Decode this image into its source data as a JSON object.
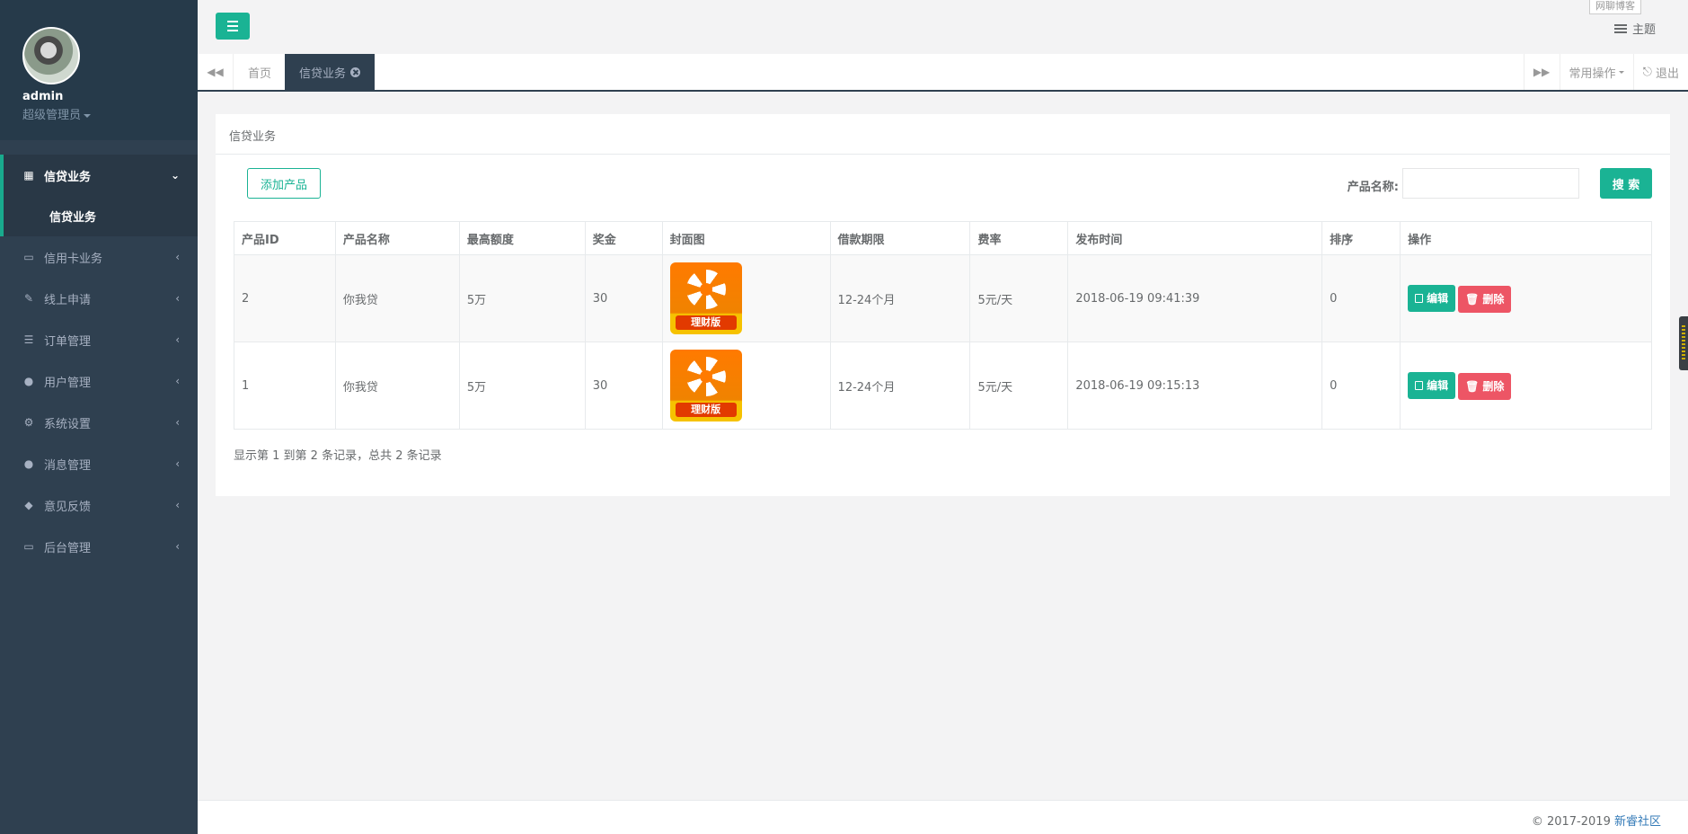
{
  "user": {
    "name": "admin",
    "role": "超级管理员"
  },
  "sidebar": {
    "items": [
      {
        "label": "信贷业务",
        "icon": "calendar-icon",
        "active": true
      },
      {
        "label": "信用卡业务",
        "icon": "credit-card-icon"
      },
      {
        "label": "线上申请",
        "icon": "edit-icon"
      },
      {
        "label": "订单管理",
        "icon": "list-icon"
      },
      {
        "label": "用户管理",
        "icon": "user-icon"
      },
      {
        "label": "系统设置",
        "icon": "gears-icon"
      },
      {
        "label": "消息管理",
        "icon": "comment-icon"
      },
      {
        "label": "意见反馈",
        "icon": "tag-icon"
      },
      {
        "label": "后台管理",
        "icon": "desktop-icon"
      }
    ],
    "sub_item": "信贷业务"
  },
  "topbar": {
    "theme_label": "主题",
    "tooltip": "网聊博客"
  },
  "tabs": {
    "home": "首页",
    "current": "信贷业务",
    "common_ops": "常用操作",
    "logout": "退出"
  },
  "panel": {
    "title": "信贷业务",
    "add_button": "添加产品",
    "search_label": "产品名称:",
    "search_value": "",
    "search_button": "搜 索"
  },
  "table": {
    "headers": [
      "产品ID",
      "产品名称",
      "最高额度",
      "奖金",
      "封面图",
      "借款期限",
      "费率",
      "发布时间",
      "排序",
      "操作"
    ],
    "rows": [
      {
        "id": "2",
        "name": "你我贷",
        "max": "5万",
        "bonus": "30",
        "cover_text": "理财版",
        "term": "12-24个月",
        "rate": "5元/天",
        "time": "2018-06-19 09:41:39",
        "sort": "0"
      },
      {
        "id": "1",
        "name": "你我贷",
        "max": "5万",
        "bonus": "30",
        "cover_text": "理财版",
        "term": "12-24个月",
        "rate": "5元/天",
        "time": "2018-06-19 09:15:13",
        "sort": "0"
      }
    ],
    "edit_label": "编辑",
    "delete_label": "删除"
  },
  "pager": "显示第 1 到第 2 条记录，总共 2 条记录",
  "footer": {
    "copyright": "© 2017-2019",
    "link": "新睿社区"
  },
  "colors": {
    "sidebar": "#2f4050",
    "accent": "#1ab394",
    "danger": "#ed5565"
  }
}
